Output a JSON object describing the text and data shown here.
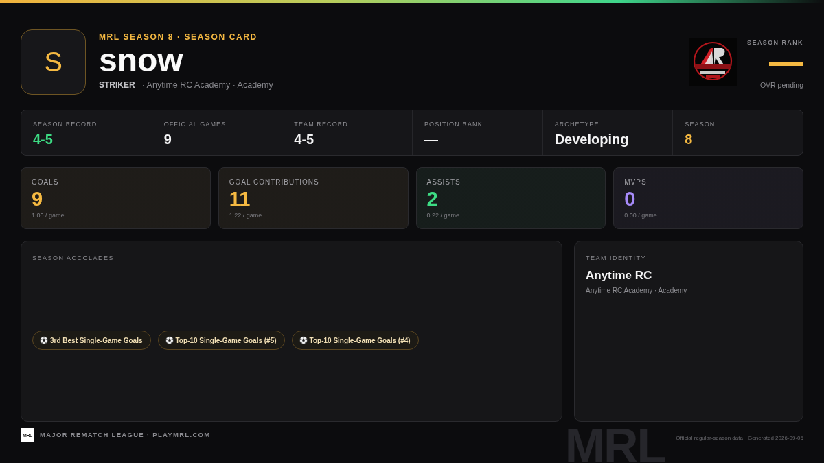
{
  "header": {
    "avatar_letter": "S",
    "eyebrow": "MRL SEASON 8 · SEASON CARD",
    "player_name": "snow",
    "position": "STRIKER",
    "affiliation": "· Anytime RC Academy · Academy"
  },
  "rank": {
    "label": "SEASON RANK",
    "value": "—",
    "note": "OVR pending"
  },
  "summary": [
    {
      "label": "SEASON RECORD",
      "value": "4-5",
      "color": "#3ddc84"
    },
    {
      "label": "OFFICIAL GAMES",
      "value": "9",
      "color": "#f4f4f5"
    },
    {
      "label": "TEAM RECORD",
      "value": "4-5",
      "color": "#f4f4f5"
    },
    {
      "label": "POSITION RANK",
      "value": "—",
      "color": "#f4f4f5"
    },
    {
      "label": "ARCHETYPE",
      "value": "Developing",
      "color": "#f4f4f5"
    },
    {
      "label": "SEASON",
      "value": "8",
      "color": "#f5b942"
    }
  ],
  "metrics": [
    {
      "label": "GOALS",
      "value": "9",
      "per_game": "1.00 / game",
      "color": "#f5b942"
    },
    {
      "label": "GOAL CONTRIBUTIONS",
      "value": "11",
      "per_game": "1.22 / game",
      "color": "#f5b942"
    },
    {
      "label": "ASSISTS",
      "value": "2",
      "per_game": "0.22 / game",
      "color": "#3ddc84"
    },
    {
      "label": "MVPS",
      "value": "0",
      "per_game": "0.00 / game",
      "color": "#a78bfa"
    }
  ],
  "accolades": {
    "title": "SEASON ACCOLADES",
    "items": [
      "3rd Best Single-Game Goals",
      "Top-10 Single-Game Goals (#5)",
      "Top-10 Single-Game Goals (#4)"
    ]
  },
  "team_identity": {
    "title": "TEAM IDENTITY",
    "team": "Anytime RC",
    "detail": "Anytime RC Academy · Academy"
  },
  "footer": {
    "logo_text": "MRL",
    "league": "MAJOR REMATCH LEAGUE · PLAYMRL.COM",
    "backdrop_text": "MRL",
    "generated": "Official regular-season data · Generated 2026-09-05"
  }
}
